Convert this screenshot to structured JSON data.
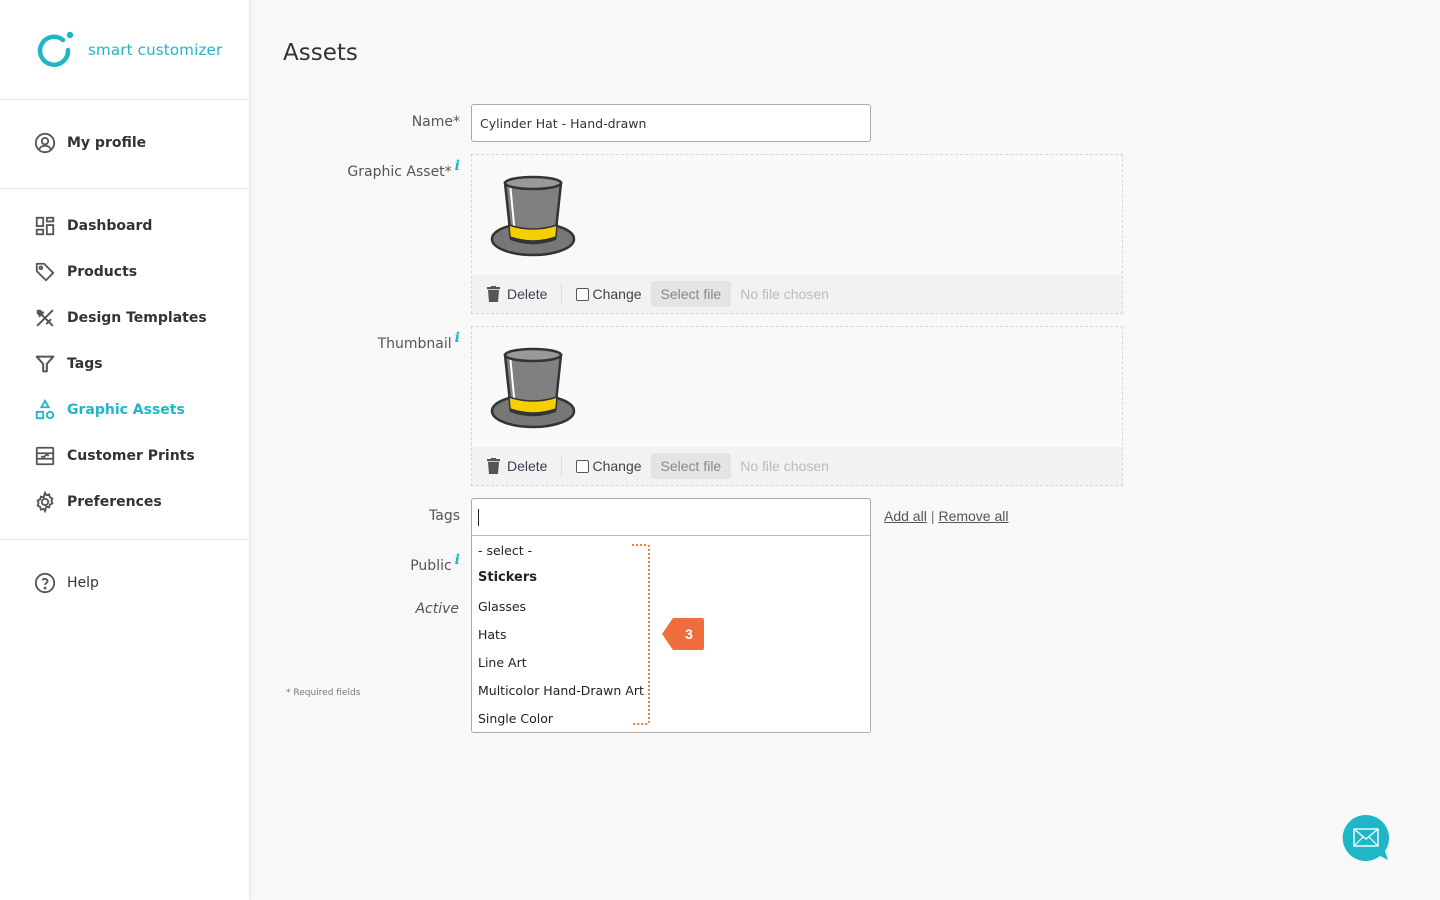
{
  "brand": {
    "name": "smart customizer",
    "accent_color": "#1fb6c8"
  },
  "sidebar": {
    "profile": {
      "label": "My profile",
      "icon": "user-circle-icon"
    },
    "items": [
      {
        "label": "Dashboard",
        "icon": "dashboard-icon",
        "active": false
      },
      {
        "label": "Products",
        "icon": "tag-icon",
        "active": false
      },
      {
        "label": "Design Templates",
        "icon": "design-tools-icon",
        "active": false
      },
      {
        "label": "Tags",
        "icon": "filter-icon",
        "active": false
      },
      {
        "label": "Graphic Assets",
        "icon": "shapes-icon",
        "active": true
      },
      {
        "label": "Customer Prints",
        "icon": "prints-icon",
        "active": false
      },
      {
        "label": "Preferences",
        "icon": "gear-icon",
        "active": false
      }
    ],
    "help": {
      "label": "Help",
      "icon": "question-circle-icon"
    }
  },
  "page": {
    "title": "Assets"
  },
  "form": {
    "name": {
      "label": "Name*",
      "value": "Cylinder Hat - Hand-drawn"
    },
    "graphic_asset": {
      "label": "Graphic Asset*",
      "info": "i",
      "preview": "top-hat-image",
      "delete_label": "Delete",
      "change_label": "Change",
      "change_checked": false,
      "select_file_label": "Select file",
      "file_status": "No file chosen"
    },
    "thumbnail": {
      "label": "Thumbnail",
      "info": "i",
      "preview": "top-hat-image",
      "delete_label": "Delete",
      "change_label": "Change",
      "change_checked": false,
      "select_file_label": "Select file",
      "file_status": "No file chosen"
    },
    "tags": {
      "label": "Tags",
      "value": "",
      "add_all": "Add all",
      "separator": "|",
      "remove_all": "Remove all",
      "options": [
        {
          "label": "- select -",
          "group": false
        },
        {
          "label": "Stickers",
          "group": true
        },
        {
          "label": "Glasses",
          "group": false
        },
        {
          "label": "Hats",
          "group": false
        },
        {
          "label": "Line Art",
          "group": false
        },
        {
          "label": "Multicolor Hand-Drawn Art",
          "group": false
        },
        {
          "label": "Single Color",
          "group": false
        }
      ],
      "annotation_badge": "3",
      "annotation_color": "#f07b4a"
    },
    "public": {
      "label": "Public",
      "info": "i"
    },
    "active": {
      "label": "Active"
    },
    "required_note": "* Required fields"
  },
  "chat": {
    "icon": "envelope-chat-icon"
  }
}
